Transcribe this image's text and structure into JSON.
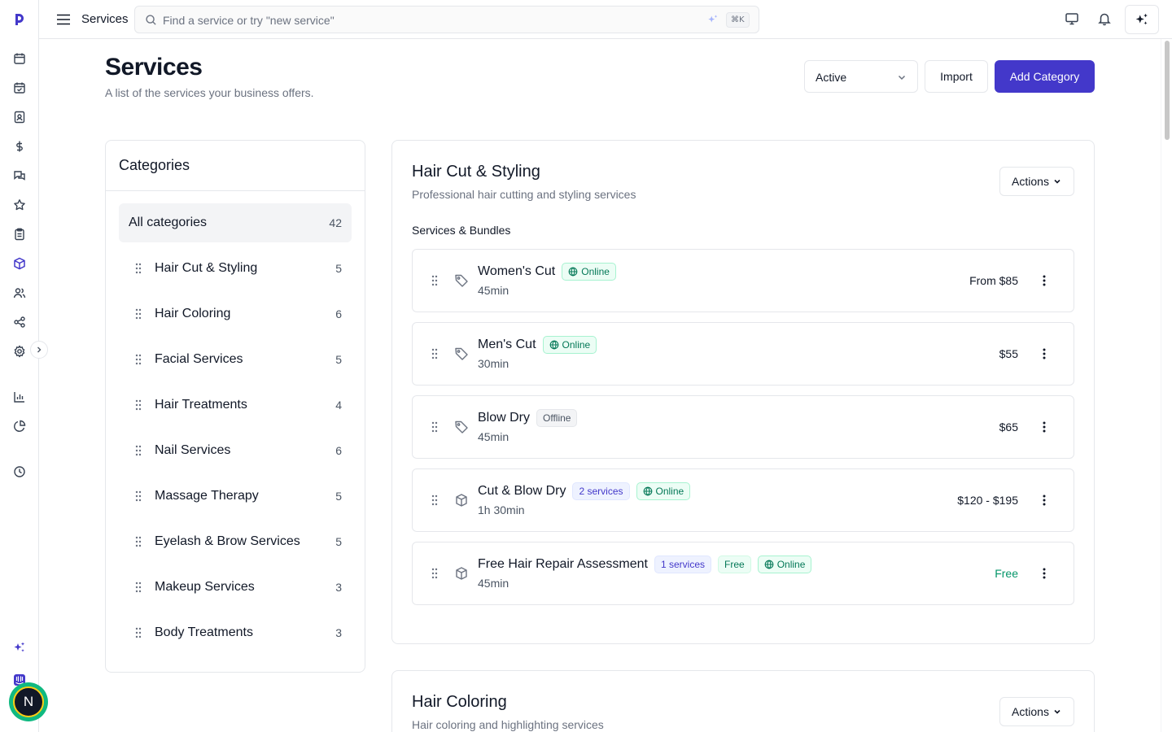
{
  "topbar": {
    "title": "Services",
    "search_placeholder": "Find a service or try \"new service\"",
    "shortcut": "⌘K"
  },
  "header": {
    "title": "Services",
    "subtitle": "A list of the services your business offers.",
    "filter_value": "Active",
    "import_label": "Import",
    "add_category_label": "Add Category"
  },
  "sidebar_profile": {
    "initial": "N"
  },
  "categories": {
    "title": "Categories",
    "all": {
      "label": "All categories",
      "count": "42"
    },
    "items": [
      {
        "label": "Hair Cut & Styling",
        "count": "5"
      },
      {
        "label": "Hair Coloring",
        "count": "6"
      },
      {
        "label": "Facial Services",
        "count": "5"
      },
      {
        "label": "Hair Treatments",
        "count": "4"
      },
      {
        "label": "Nail Services",
        "count": "6"
      },
      {
        "label": "Massage Therapy",
        "count": "5"
      },
      {
        "label": "Eyelash & Brow Services",
        "count": "5"
      },
      {
        "label": "Makeup Services",
        "count": "3"
      },
      {
        "label": "Body Treatments",
        "count": "3"
      }
    ]
  },
  "category_cards": [
    {
      "title": "Hair Cut & Styling",
      "description": "Professional hair cutting and styling services",
      "actions_label": "Actions",
      "section_label": "Services & Bundles",
      "services": [
        {
          "name": "Women's Cut",
          "duration": "45min",
          "price": "From $85",
          "status": "Online",
          "kind": "tag-icon"
        },
        {
          "name": "Men's Cut",
          "duration": "30min",
          "price": "$55",
          "status": "Online",
          "kind": "tag-icon"
        },
        {
          "name": "Blow Dry",
          "duration": "45min",
          "price": "$65",
          "status": "Offline",
          "kind": "tag-icon"
        },
        {
          "name": "Cut & Blow Dry",
          "duration": "1h 30min",
          "price": "$120 - $195",
          "count_badge": "2 services",
          "status": "Online",
          "kind": "package-icon"
        },
        {
          "name": "Free Hair Repair Assessment",
          "duration": "45min",
          "price": "Free",
          "count_badge": "1 services",
          "free_badge": "Free",
          "status": "Online",
          "kind": "package-icon"
        }
      ]
    },
    {
      "title": "Hair Coloring",
      "description": "Hair coloring and highlighting services",
      "actions_label": "Actions"
    }
  ],
  "colors": {
    "primary": "#4338ca",
    "online": "#047857",
    "offline": "#4b5563",
    "free_price": "#059669"
  }
}
